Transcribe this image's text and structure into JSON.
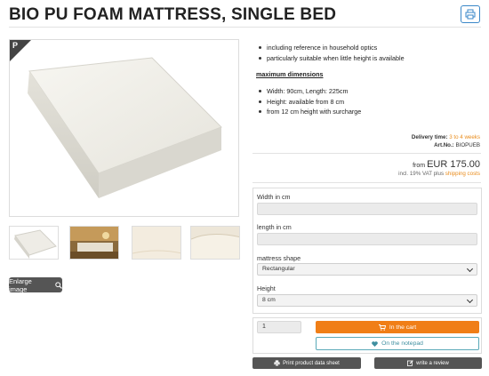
{
  "product": {
    "title": "BIO PU FOAM MATTRESS, SINGLE BED",
    "badge_letter": "P"
  },
  "features": {
    "top_items": [
      "including reference in household optics",
      "particularly suitable when little height is available"
    ],
    "max_dimensions_heading": "maximum dimensions",
    "dimension_items": [
      "Width: 90cm, Length: 225cm",
      "Height: available from 8 cm",
      "from 12 cm height with surcharge"
    ]
  },
  "delivery": {
    "label": "Delivery time:",
    "value": "3 to 4 weeks",
    "art_label": "Art.No.:",
    "art_value": "BIOPUEB"
  },
  "price": {
    "prefix": "from",
    "value": "EUR 175.00",
    "vat_text": "incl. 19% VAT plus",
    "shipping_link": "shipping costs"
  },
  "options": {
    "width_label": "Width in cm",
    "width_value": "",
    "length_label": "length in cm",
    "length_value": "",
    "shape_label": "mattress shape",
    "shape_selected": "Rectangular",
    "height_label": "Height",
    "height_selected": "8 cm"
  },
  "cart": {
    "quantity": "1",
    "cart_label": "In the cart",
    "notepad_label": "On the notepad"
  },
  "buttons": {
    "enlarge_label": "Enlarge image",
    "print_sheet_label": "Print product data sheet",
    "review_label": "write a review"
  },
  "colors": {
    "accent_orange": "#f07e17",
    "accent_teal": "#5aa9b8",
    "dark_button": "#555555",
    "print_icon_blue": "#3a87c8"
  }
}
